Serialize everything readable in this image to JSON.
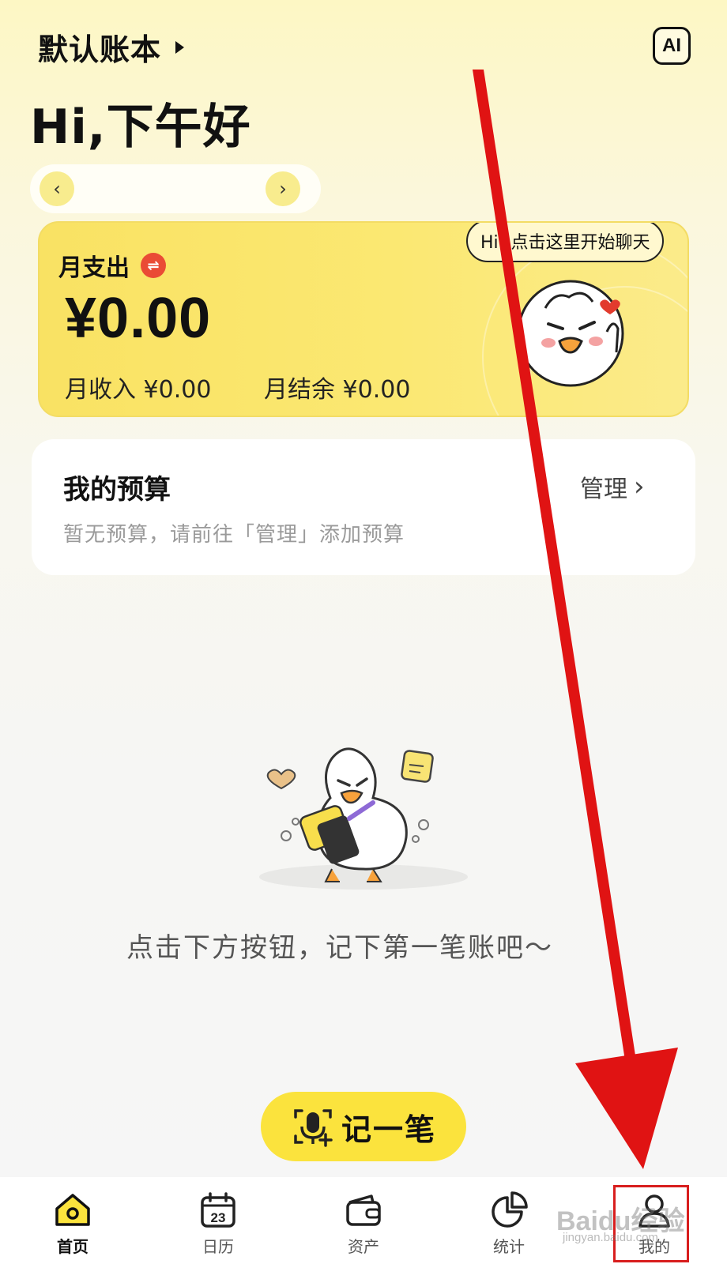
{
  "header": {
    "ledger_name": "默认账本",
    "ai_label": "AI",
    "greeting": "Hi,下午好"
  },
  "date_switcher": {
    "prev_symbol": "‹",
    "next_symbol": "›"
  },
  "month_card": {
    "expense_label": "月支出",
    "expense_amount": "¥0.00",
    "income": "月收入 ¥0.00",
    "balance": "月结余 ¥0.00",
    "chat_bubble": "Hi! 点击这里开始聊天",
    "swap_icon": "⇌"
  },
  "budget": {
    "title": "我的预算",
    "manage": "管理",
    "manage_chevron": "›",
    "empty": "暂无预算，请前往「管理」添加预算"
  },
  "empty_state": {
    "text": "点击下方按钮，记下第一笔账吧～"
  },
  "record_button": {
    "label": "记一笔"
  },
  "tabbar": {
    "tabs": [
      {
        "label": "首页",
        "icon": "home-icon",
        "active": true
      },
      {
        "label": "日历",
        "icon": "calendar-icon",
        "day": "23"
      },
      {
        "label": "资产",
        "icon": "wallet-icon"
      },
      {
        "label": "统计",
        "icon": "pie-chart-icon"
      },
      {
        "label": "我的",
        "icon": "profile-icon"
      }
    ]
  },
  "watermark": {
    "main": "Baidu经验",
    "sub": "jingyan.baidu.com"
  },
  "colors": {
    "accent_yellow": "#fbe33d",
    "card_yellow": "#f9e263",
    "annotation_red": "#e01313"
  }
}
